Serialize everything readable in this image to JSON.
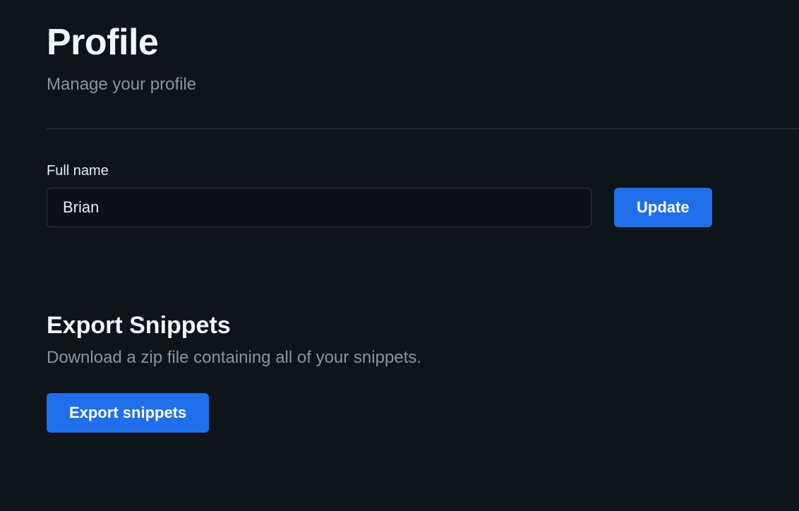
{
  "header": {
    "title": "Profile",
    "subtitle": "Manage your profile"
  },
  "form": {
    "full_name_label": "Full name",
    "full_name_value": "Brian",
    "update_button": "Update"
  },
  "export": {
    "title": "Export Snippets",
    "description": "Download a zip file containing all of your snippets.",
    "button": "Export snippets"
  }
}
